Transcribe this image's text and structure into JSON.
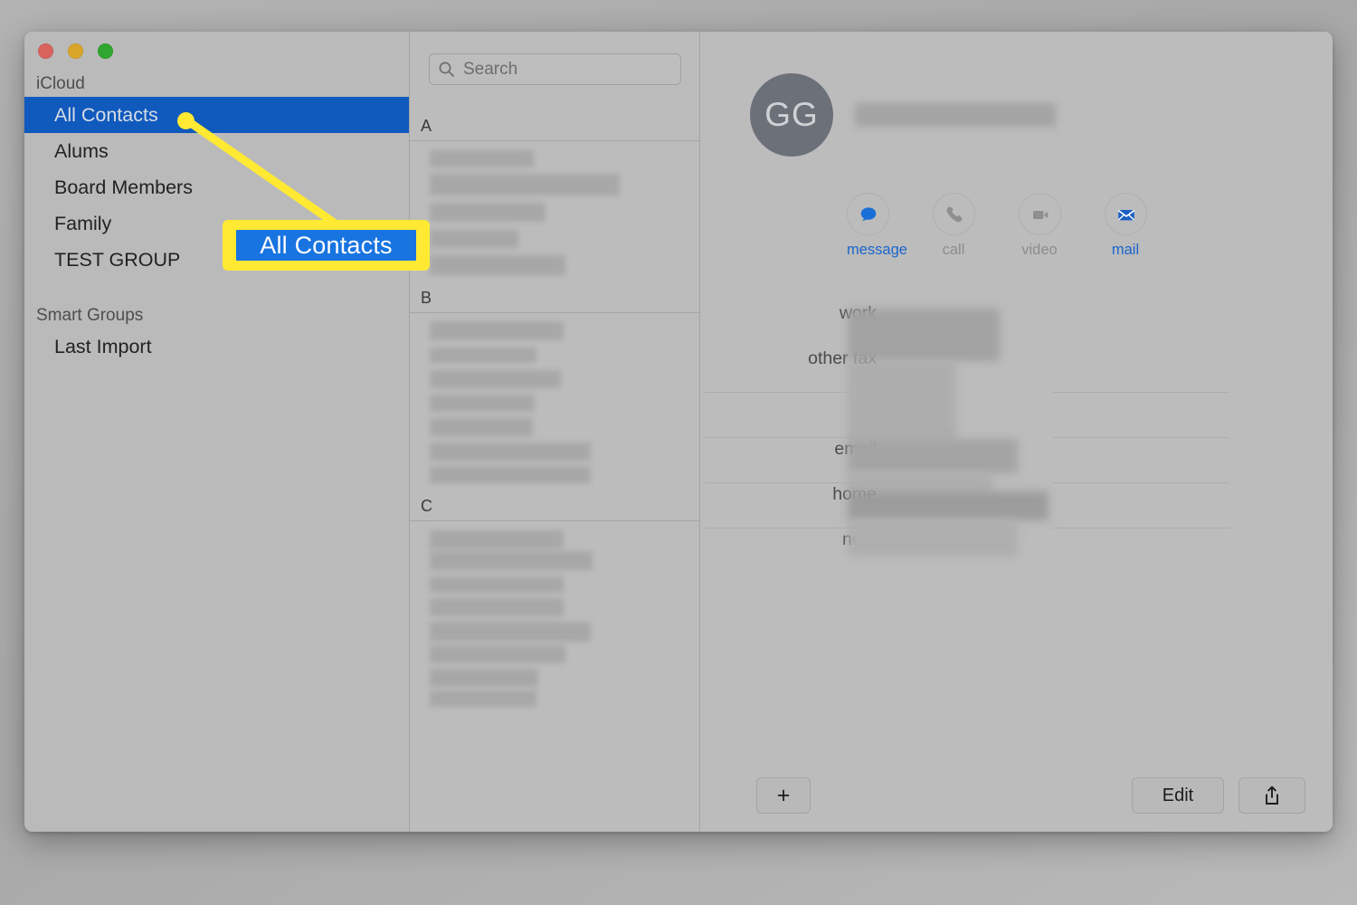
{
  "window": {
    "traffic_lights": [
      "close",
      "minimize",
      "zoom"
    ]
  },
  "sidebar": {
    "sections": [
      {
        "header": "iCloud",
        "items": [
          {
            "label": "All Contacts",
            "selected": true
          },
          {
            "label": "Alums",
            "selected": false
          },
          {
            "label": "Board Members",
            "selected": false
          },
          {
            "label": "Family",
            "selected": false
          },
          {
            "label": "TEST GROUP",
            "selected": false
          }
        ]
      },
      {
        "header": "Smart Groups",
        "items": [
          {
            "label": "Last Import",
            "selected": false
          }
        ]
      }
    ]
  },
  "list": {
    "search": {
      "placeholder": "Search",
      "value": "",
      "icon": "search-icon"
    },
    "sections": [
      {
        "letter": "A",
        "blurred_rows": 5
      },
      {
        "letter": "B",
        "blurred_rows": 7
      },
      {
        "letter": "C",
        "blurred_rows": 8
      }
    ]
  },
  "detail": {
    "avatar_initials": "GG",
    "name_redacted": true,
    "actions": [
      {
        "label": "message",
        "icon": "chat-bubble-icon",
        "state": "active"
      },
      {
        "label": "call",
        "icon": "phone-icon",
        "state": "disabled"
      },
      {
        "label": "video",
        "icon": "video-camera-icon",
        "state": "disabled"
      },
      {
        "label": "mail",
        "icon": "envelope-icon",
        "state": "active"
      }
    ],
    "fields": [
      {
        "label": "work",
        "value_redacted": true
      },
      {
        "label": "other fax",
        "value_redacted": true
      },
      {
        "label": "",
        "value_redacted": true
      },
      {
        "label": "",
        "value_redacted": true
      },
      {
        "label": "email",
        "value_redacted": true
      },
      {
        "label": "home",
        "value_redacted": true
      },
      {
        "label": "note",
        "value_redacted": false
      }
    ],
    "toolbar": {
      "add_label": "+",
      "edit_label": "Edit",
      "share_icon": "share-icon"
    }
  },
  "annotation": {
    "callout_label": "All Contacts",
    "highlight_color": "#ffe933",
    "callout_fill": "#1874e0",
    "points_to": "sidebar-item-all-contacts"
  }
}
